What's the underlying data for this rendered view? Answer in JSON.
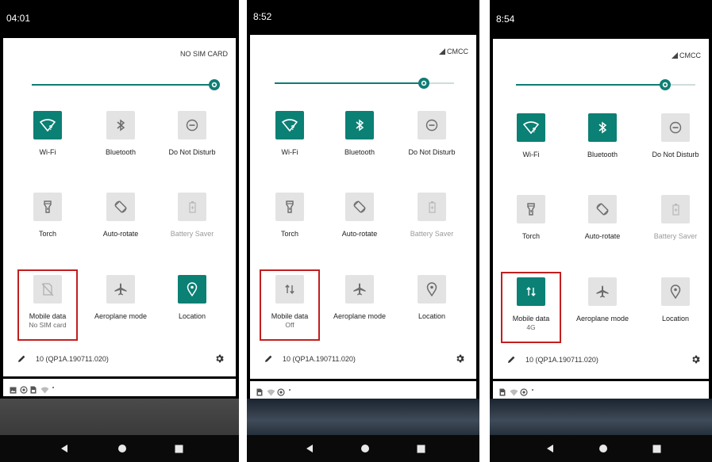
{
  "phones": [
    {
      "time": "04:01",
      "carrier": "NO SIM CARD",
      "carrier_has_signal": false,
      "brightness_percent": 100,
      "tiles": [
        {
          "label": "Wi-Fi",
          "icon": "wifi-question-icon",
          "active": true
        },
        {
          "label": "Bluetooth",
          "icon": "bluetooth-icon",
          "active": false
        },
        {
          "label": "Do Not Disturb",
          "icon": "dnd-icon",
          "active": false
        },
        {
          "label": "Torch",
          "icon": "torch-icon",
          "active": false
        },
        {
          "label": "Auto-rotate",
          "icon": "auto-rotate-icon",
          "active": false
        },
        {
          "label": "Battery Saver",
          "icon": "battery-saver-icon",
          "active": false,
          "dimmed": true
        },
        {
          "label": "Mobile data",
          "sublabel": "No SIM card",
          "icon": "no-sim-icon",
          "active": false,
          "highlighted": true
        },
        {
          "label": "Aeroplane mode",
          "icon": "airplane-icon",
          "active": false
        },
        {
          "label": "Location",
          "icon": "location-icon",
          "active": true
        }
      ],
      "build": "10 (QP1A.190711.020)",
      "notification_icons": [
        "image-icon",
        "sync-icon",
        "sim-icon",
        "wifi-icon"
      ]
    },
    {
      "time": "8:52",
      "carrier": "CMCC",
      "carrier_has_signal": true,
      "brightness_percent": 83,
      "tiles": [
        {
          "label": "Wi-Fi",
          "icon": "wifi-question-icon",
          "active": true
        },
        {
          "label": "Bluetooth",
          "icon": "bluetooth-icon",
          "active": true
        },
        {
          "label": "Do Not Disturb",
          "icon": "dnd-icon",
          "active": false
        },
        {
          "label": "Torch",
          "icon": "torch-icon",
          "active": false
        },
        {
          "label": "Auto-rotate",
          "icon": "auto-rotate-icon",
          "active": false
        },
        {
          "label": "Battery Saver",
          "icon": "battery-saver-icon",
          "active": false,
          "dimmed": true
        },
        {
          "label": "Mobile data",
          "sublabel": "Off",
          "icon": "data-arrows-icon",
          "active": false,
          "highlighted": true
        },
        {
          "label": "Aeroplane mode",
          "icon": "airplane-icon",
          "active": false
        },
        {
          "label": "Location",
          "icon": "location-icon",
          "active": false
        }
      ],
      "build": "10 (QP1A.190711.020)",
      "notification_icons": [
        "sim-icon",
        "wifi-icon",
        "sync-icon"
      ]
    },
    {
      "time": "8:54",
      "carrier": "CMCC",
      "carrier_has_signal": true,
      "brightness_percent": 83,
      "tiles": [
        {
          "label": "Wi-Fi",
          "icon": "wifi-question-icon",
          "active": true
        },
        {
          "label": "Bluetooth",
          "icon": "bluetooth-icon",
          "active": true
        },
        {
          "label": "Do Not Disturb",
          "icon": "dnd-icon",
          "active": false
        },
        {
          "label": "Torch",
          "icon": "torch-icon",
          "active": false
        },
        {
          "label": "Auto-rotate",
          "icon": "auto-rotate-icon",
          "active": false
        },
        {
          "label": "Battery Saver",
          "icon": "battery-saver-icon",
          "active": false,
          "dimmed": true
        },
        {
          "label": "Mobile data",
          "sublabel": "4G",
          "icon": "data-arrows-icon",
          "active": true,
          "highlighted": true
        },
        {
          "label": "Aeroplane mode",
          "icon": "airplane-icon",
          "active": false
        },
        {
          "label": "Location",
          "icon": "location-icon",
          "active": false
        }
      ],
      "build": "10 (QP1A.190711.020)",
      "notification_icons": [
        "sim-icon",
        "wifi-icon",
        "sync-icon"
      ]
    }
  ],
  "colors": {
    "accent": "#0b8074",
    "tile_off": "#e3e3e3",
    "highlight": "#c21f1f",
    "statusbar": "#000000"
  }
}
